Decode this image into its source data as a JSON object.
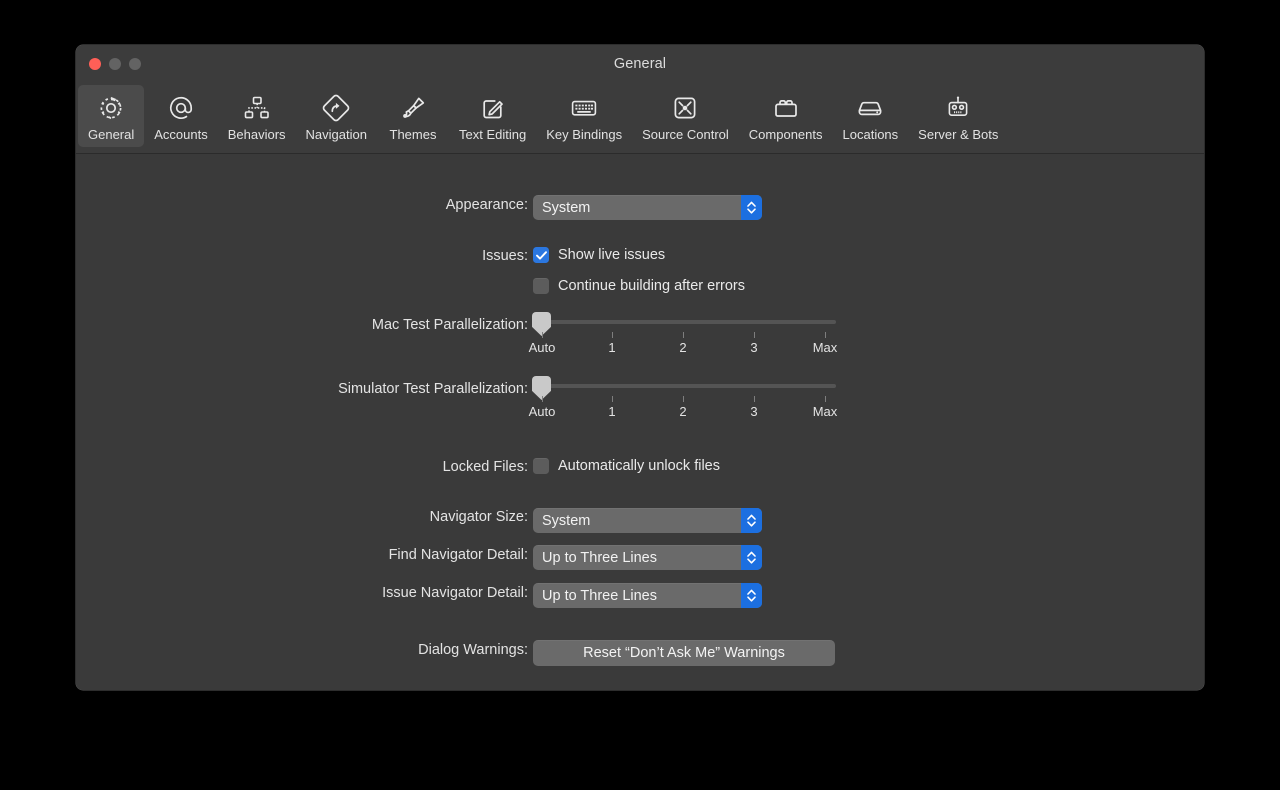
{
  "window": {
    "title": "General",
    "traffic_lights": [
      "close",
      "minimize",
      "zoom"
    ]
  },
  "toolbar": {
    "selected": "General",
    "items": [
      {
        "label": "General",
        "icon": "gear-icon"
      },
      {
        "label": "Accounts",
        "icon": "at-sign-icon"
      },
      {
        "label": "Behaviors",
        "icon": "hierarchy-icon"
      },
      {
        "label": "Navigation",
        "icon": "road-sign-arrow-icon"
      },
      {
        "label": "Themes",
        "icon": "paintbrush-icon"
      },
      {
        "label": "Text Editing",
        "icon": "pencil-square-icon"
      },
      {
        "label": "Key Bindings",
        "icon": "keyboard-icon"
      },
      {
        "label": "Source Control",
        "icon": "branch-merge-icon"
      },
      {
        "label": "Components",
        "icon": "toolbox-icon"
      },
      {
        "label": "Locations",
        "icon": "hard-drive-icon"
      },
      {
        "label": "Server & Bots",
        "icon": "robot-icon"
      }
    ]
  },
  "settings": {
    "appearance": {
      "label": "Appearance:",
      "value": "System"
    },
    "issues": {
      "label": "Issues:",
      "show_live_issues": {
        "label": "Show live issues",
        "checked": true
      },
      "continue_building": {
        "label": "Continue building after errors",
        "checked": false
      }
    },
    "mac_test_parallelization": {
      "label": "Mac Test Parallelization:",
      "value": "Auto",
      "ticks": [
        "Auto",
        "1",
        "2",
        "3",
        "Max"
      ]
    },
    "simulator_test_parallelization": {
      "label": "Simulator Test Parallelization:",
      "value": "Auto",
      "ticks": [
        "Auto",
        "1",
        "2",
        "3",
        "Max"
      ]
    },
    "locked_files": {
      "label": "Locked Files:",
      "auto_unlock": {
        "label": "Automatically unlock files",
        "checked": false
      }
    },
    "navigator_size": {
      "label": "Navigator Size:",
      "value": "System"
    },
    "find_navigator_detail": {
      "label": "Find Navigator Detail:",
      "value": "Up to Three Lines"
    },
    "issue_navigator_detail": {
      "label": "Issue Navigator Detail:",
      "value": "Up to Three Lines"
    },
    "dialog_warnings": {
      "label": "Dialog Warnings:",
      "button_label": "Reset “Don’t Ask Me” Warnings"
    }
  },
  "colors": {
    "accent_blue": "#2b77e0",
    "popup_chevron_blue": "#1c6fe0",
    "window_bg": "#3a3a3a",
    "titlebar_bg": "#3c3c3c",
    "close_red": "#ff5f57"
  }
}
